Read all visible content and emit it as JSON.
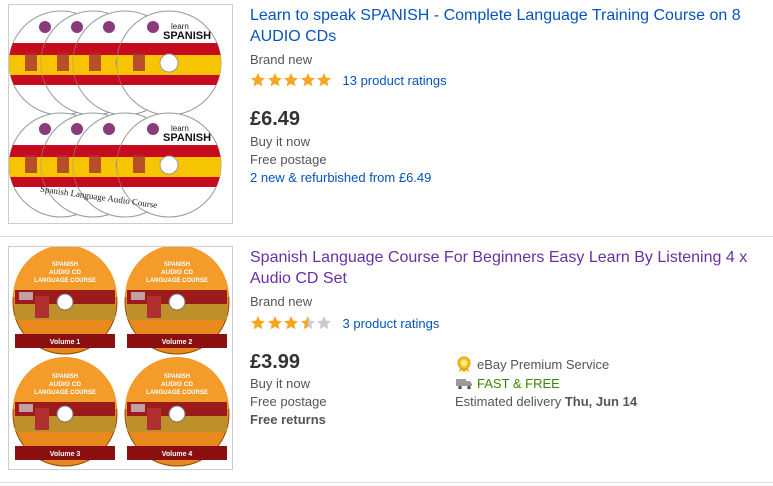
{
  "colors": {
    "link": "#0654ba",
    "visited": "#6a2fa5",
    "star_on": "#f5a623",
    "star_off": "#cccccc",
    "fast": "#3a8a00"
  },
  "listings": [
    {
      "title": "Learn to speak SPANISH - Complete Language Training Course on 8 AUDIO CDs",
      "condition": "Brand new",
      "stars": 5,
      "ratings_text": "13 product ratings",
      "price": "£6.49",
      "buy": "Buy it now",
      "postage": "Free postage",
      "refurb": "2 new & refurbished from £6.49",
      "disc_texts": {
        "brand_top": "learn",
        "brand_bottom": "SPANISH",
        "rim": "Spanish Language Audio Course"
      }
    },
    {
      "title": "Spanish Language Course For Beginners Easy Learn By Listening 4 x Audio CD Set",
      "condition": "Brand new",
      "stars": 3.5,
      "ratings_text": "3 product ratings",
      "price": "£3.99",
      "buy": "Buy it now",
      "postage": "Free postage",
      "returns": "Free returns",
      "premium": "eBay Premium Service",
      "fast": "FAST & FREE",
      "delivery_label": "Estimated delivery",
      "delivery_date": "Thu, Jun 14",
      "disc_texts": {
        "l1": "SPANISH",
        "l2": "AUDIO CD",
        "l3": "LANGUAGE COURSE",
        "volumes": [
          "Volume 1",
          "Volume 2",
          "Volume 3",
          "Volume 4"
        ]
      }
    }
  ]
}
